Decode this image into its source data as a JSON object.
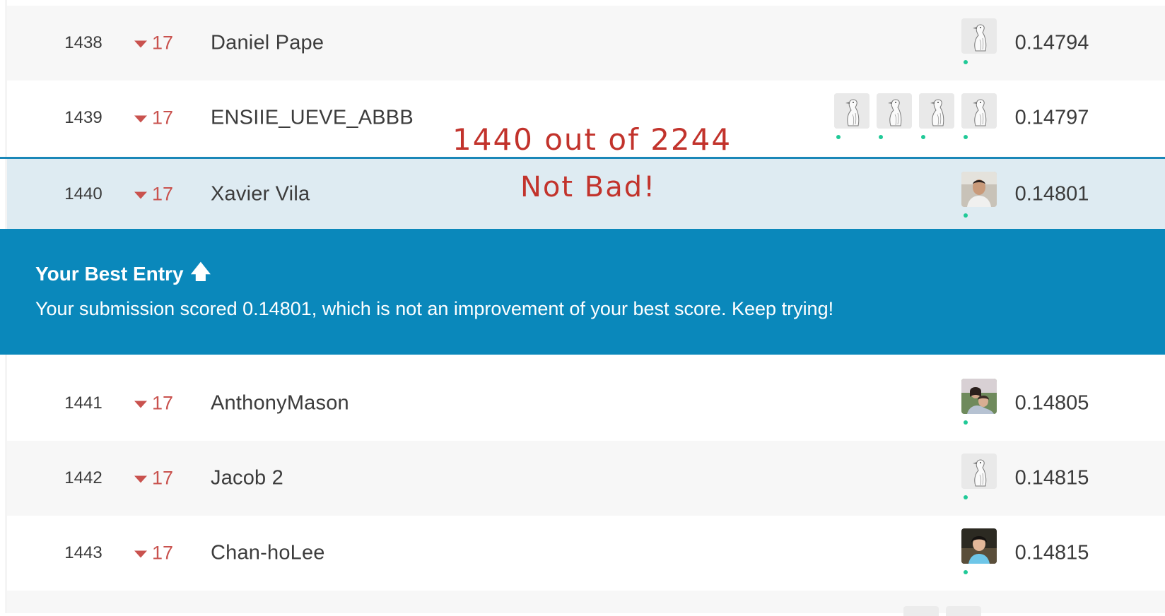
{
  "leaderboard": {
    "rows": [
      {
        "rank": "1438",
        "change": "17",
        "team": "Daniel Pape",
        "score": "0.14794",
        "members": [
          "default-avatar"
        ]
      },
      {
        "rank": "1439",
        "change": "17",
        "team": "ENSIIE_UEVE_ABBB",
        "score": "0.14797",
        "members": [
          "default-avatar",
          "default-avatar",
          "default-avatar",
          "default-avatar"
        ]
      },
      {
        "rank": "1440",
        "change": "17",
        "team": "Xavier Vila",
        "score": "0.14801",
        "members": [
          "photo-avatar"
        ]
      },
      {
        "rank": "1441",
        "change": "17",
        "team": "AnthonyMason",
        "score": "0.14805",
        "members": [
          "photo-avatar"
        ]
      },
      {
        "rank": "1442",
        "change": "17",
        "team": "Jacob 2",
        "score": "0.14815",
        "members": [
          "default-avatar"
        ]
      },
      {
        "rank": "1443",
        "change": "17",
        "team": "Chan-hoLee",
        "score": "0.14815",
        "members": [
          "photo-avatar"
        ]
      }
    ]
  },
  "banner": {
    "title": "Your Best Entry",
    "arrow": "🡅",
    "message": "Your submission scored 0.14801, which is not an improvement of your best score. Keep trying!"
  },
  "annotations": {
    "rank_note": "1440 out of 2244",
    "praise": "Not Bad!"
  },
  "colors": {
    "banner": "#0a88bb",
    "highlight_row": "#deebf2",
    "rank_drop": "#c9524e",
    "online": "#20c997",
    "annotation": "#c2332c"
  }
}
